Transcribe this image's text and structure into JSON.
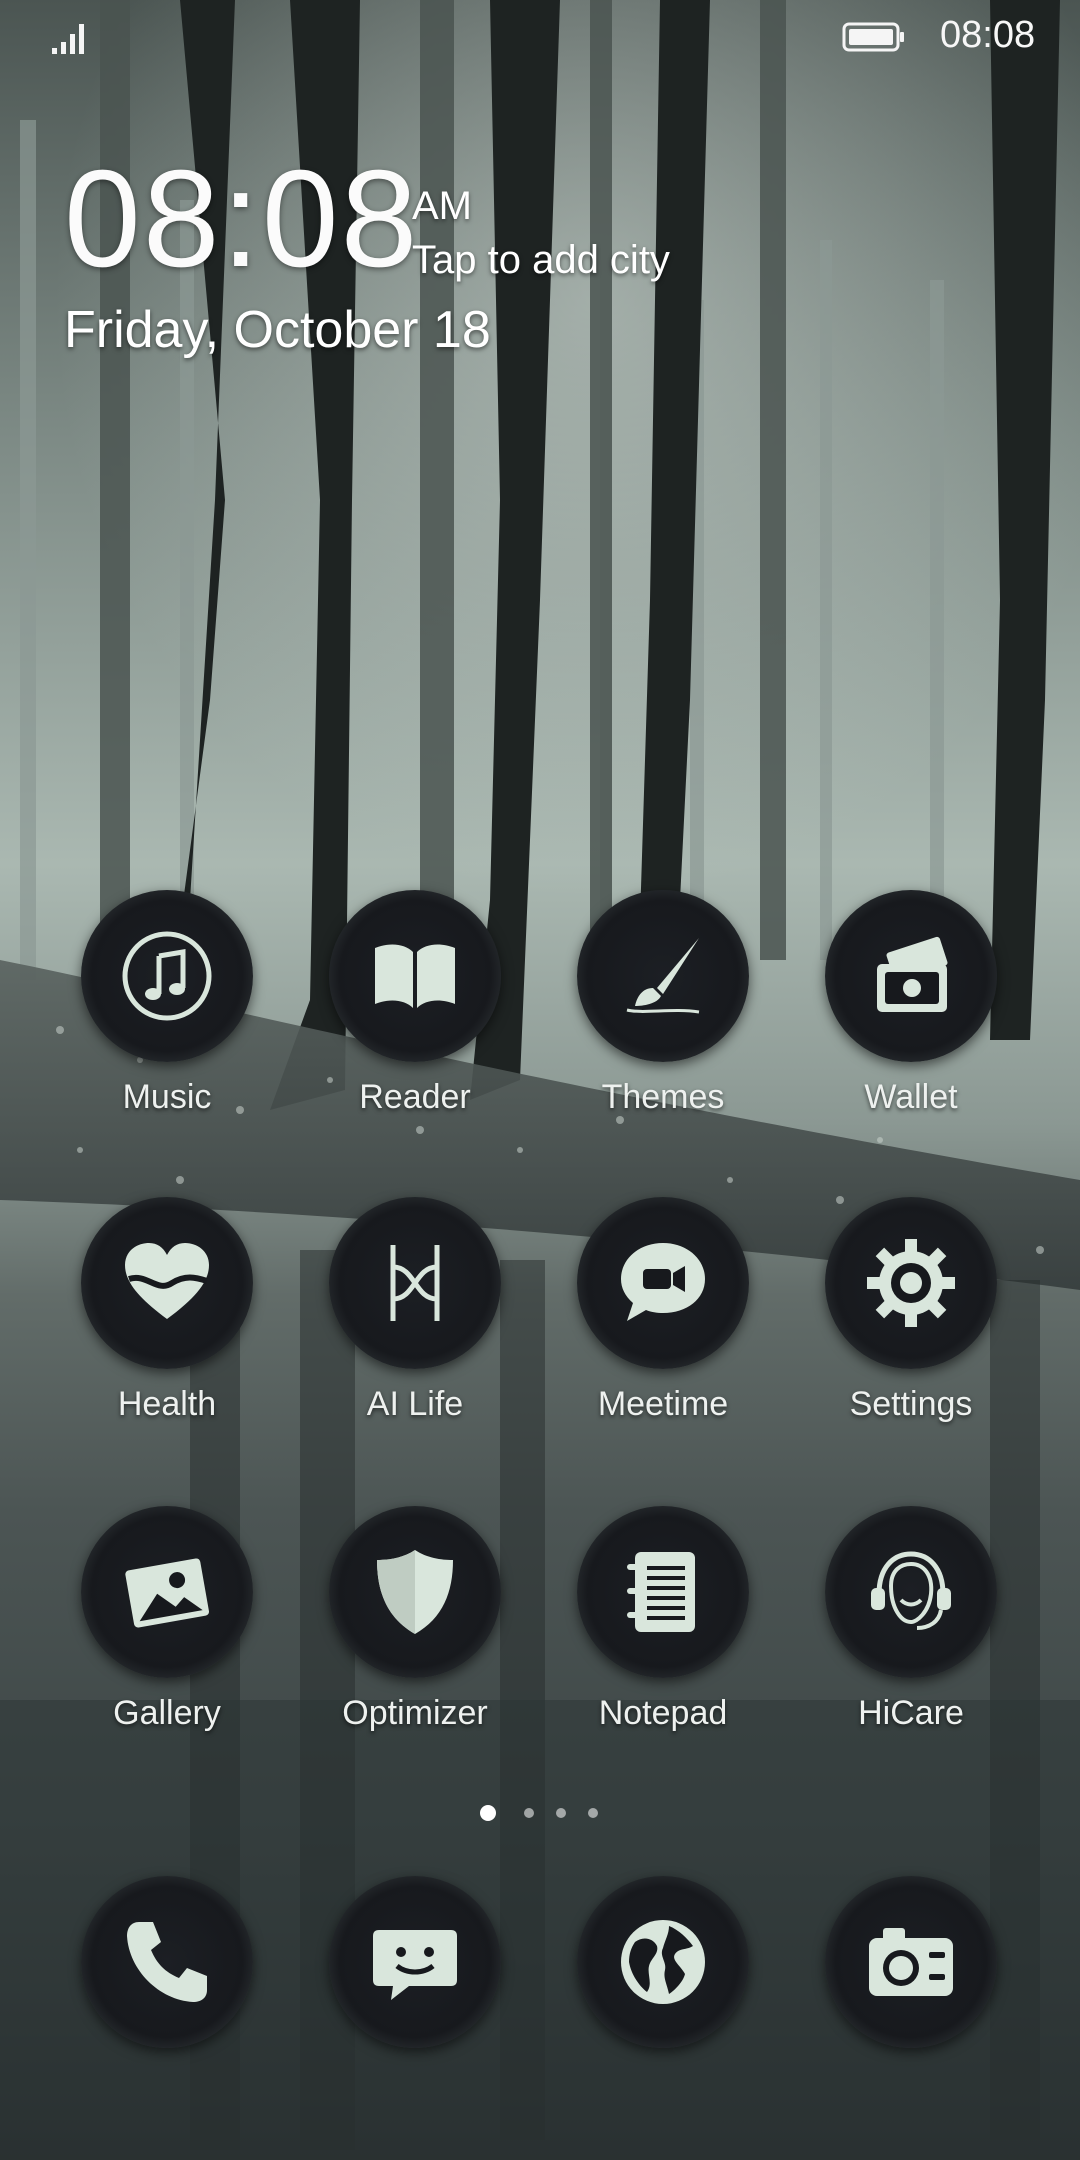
{
  "status_bar": {
    "time": "08:08",
    "signal_icon": "signal-bars-icon",
    "battery_icon": "battery-full-icon"
  },
  "clock_widget": {
    "time": "08:08",
    "ampm": "AM",
    "weather_prompt": "Tap to add city",
    "date": "Friday, October 18"
  },
  "apps": [
    {
      "label": "Music",
      "icon": "music-note-icon"
    },
    {
      "label": "Reader",
      "icon": "open-book-icon"
    },
    {
      "label": "Themes",
      "icon": "paintbrush-icon"
    },
    {
      "label": "Wallet",
      "icon": "wallet-cash-icon"
    },
    {
      "label": "Health",
      "icon": "heart-icon"
    },
    {
      "label": "AI Life",
      "icon": "ai-life-icon"
    },
    {
      "label": "Meetime",
      "icon": "video-chat-icon"
    },
    {
      "label": "Settings",
      "icon": "gear-icon"
    },
    {
      "label": "Gallery",
      "icon": "picture-icon"
    },
    {
      "label": "Optimizer",
      "icon": "shield-icon"
    },
    {
      "label": "Notepad",
      "icon": "notepad-icon"
    },
    {
      "label": "HiCare",
      "icon": "headset-icon"
    }
  ],
  "page_indicator": {
    "pages": 4,
    "current": 1
  },
  "dock": [
    {
      "icon": "phone-icon"
    },
    {
      "icon": "message-icon"
    },
    {
      "icon": "globe-icon"
    },
    {
      "icon": "camera-icon"
    }
  ],
  "colors": {
    "icon_glyph": "#d9e6dc",
    "icon_bg": "#17191d"
  }
}
